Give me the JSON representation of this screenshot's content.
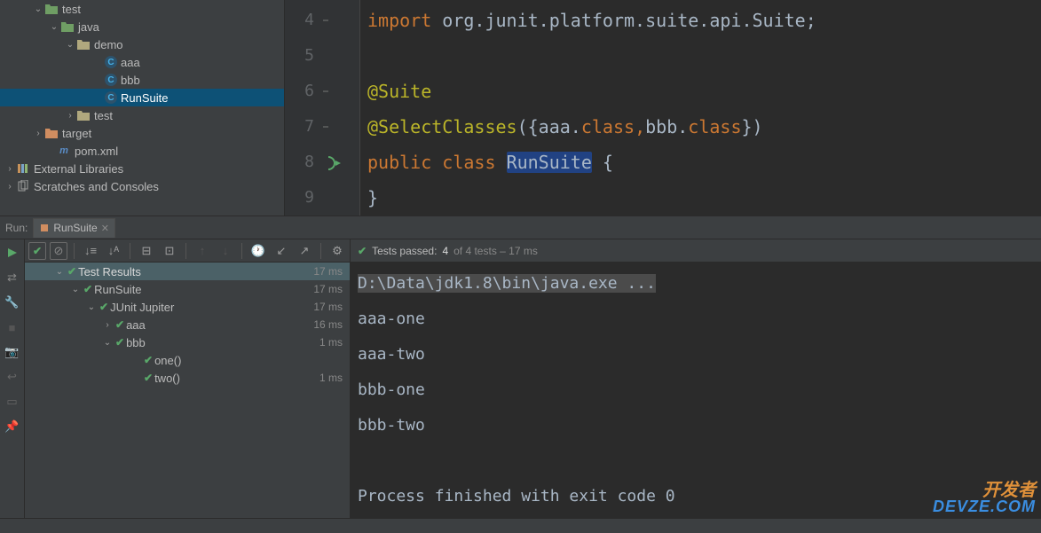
{
  "project": {
    "tree": [
      {
        "indent": 36,
        "chev": "⌄",
        "iconType": "folder-src",
        "label": "test",
        "name": "tree-folder-test"
      },
      {
        "indent": 54,
        "chev": "⌄",
        "iconType": "folder-src",
        "label": "java",
        "name": "tree-folder-java"
      },
      {
        "indent": 72,
        "chev": "⌄",
        "iconType": "folder",
        "label": "demo",
        "name": "tree-folder-demo"
      },
      {
        "indent": 104,
        "chev": "",
        "iconType": "class",
        "label": "aaa",
        "name": "tree-class-aaa"
      },
      {
        "indent": 104,
        "chev": "",
        "iconType": "class",
        "label": "bbb",
        "name": "tree-class-bbb"
      },
      {
        "indent": 104,
        "chev": "",
        "iconType": "class",
        "label": "RunSuite",
        "name": "tree-class-runsuite",
        "selected": true
      },
      {
        "indent": 72,
        "chev": "›",
        "iconType": "folder",
        "label": "test",
        "name": "tree-folder-test2"
      },
      {
        "indent": 36,
        "chev": "›",
        "iconType": "target",
        "label": "target",
        "name": "tree-folder-target"
      },
      {
        "indent": 50,
        "chev": "",
        "iconType": "pom",
        "label": "pom.xml",
        "name": "tree-file-pom"
      }
    ],
    "externalLibs": "External Libraries",
    "scratches": "Scratches and Consoles"
  },
  "editor": {
    "gutter": [
      "4",
      "5",
      "6",
      "7",
      "8",
      "9"
    ],
    "line4": {
      "kw": "import",
      "pkg": " org.junit.platform.suite.api.",
      "cls": "Suite",
      "semi": ";"
    },
    "line6": "@Suite",
    "line7": {
      "ann": "@SelectClasses",
      "open": "({",
      "a": "aaa",
      "dot1": ".",
      "c1": "class",
      "comma": ",",
      "b": "bbb",
      "dot2": ".",
      "c2": "class",
      "close": "})"
    },
    "line8": {
      "kw1": "public",
      "kw2": "class",
      "name": "RunSuite",
      "brace": " {"
    },
    "line9": "}"
  },
  "run": {
    "label": "Run:",
    "tabName": "RunSuite",
    "passed": {
      "prefix": "Tests passed:",
      "count": "4",
      "suffix": "of 4 tests – 17 ms"
    },
    "results": [
      {
        "indent": 4,
        "chev": "⌄",
        "label": "Test Results",
        "time": "17 ms",
        "header": true
      },
      {
        "indent": 22,
        "chev": "⌄",
        "label": "RunSuite",
        "time": "17 ms"
      },
      {
        "indent": 40,
        "chev": "⌄",
        "label": "JUnit Jupiter",
        "time": "17 ms"
      },
      {
        "indent": 58,
        "chev": "›",
        "label": "aaa",
        "time": "16 ms"
      },
      {
        "indent": 58,
        "chev": "⌄",
        "label": "bbb",
        "time": "1 ms"
      },
      {
        "indent": 90,
        "chev": "",
        "label": "one()",
        "time": ""
      },
      {
        "indent": 90,
        "chev": "",
        "label": "two()",
        "time": "1 ms"
      }
    ],
    "output": {
      "cmd": "D:\\Data\\jdk1.8\\bin\\java.exe ...",
      "lines": [
        "aaa-one",
        "aaa-two",
        "bbb-one",
        "bbb-two",
        "",
        "Process finished with exit code 0"
      ]
    }
  },
  "watermark": {
    "a": "开发者",
    "b": "DEVZE.COM"
  }
}
